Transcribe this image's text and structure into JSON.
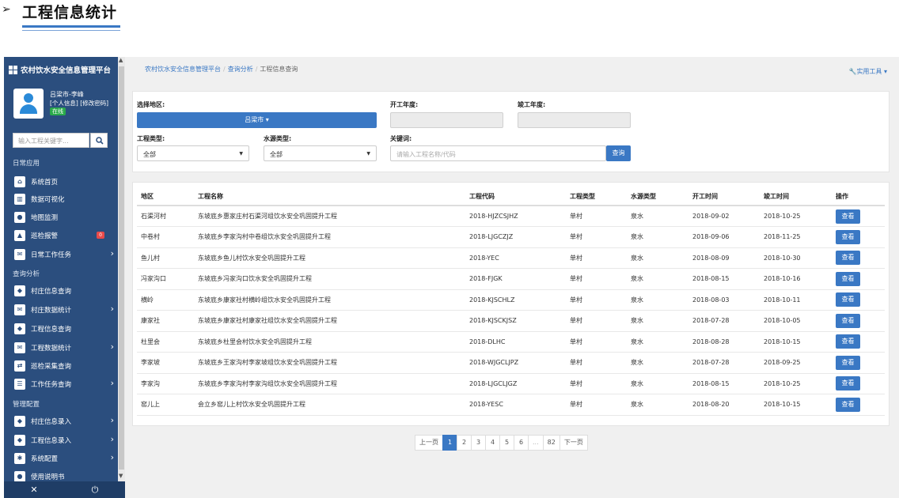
{
  "heading": {
    "arrow": "➢",
    "title": "工程信息统计"
  },
  "sidebar": {
    "brand": "农村饮水安全信息管理平台",
    "user": {
      "name": "吕梁市-李峰",
      "links": "[个人信息] [修改密码]",
      "status": "在线"
    },
    "search_placeholder": "输入工程关键字...",
    "groups": {
      "daily": "日常应用",
      "query": "查询分析",
      "config": "管理配置"
    },
    "items": [
      {
        "label": "系统首页",
        "icon": "⌂"
      },
      {
        "label": "数据可视化",
        "icon": "▥"
      },
      {
        "label": "地图监测",
        "icon": "●"
      },
      {
        "label": "巡检报警",
        "icon": "▲",
        "badge": "0"
      },
      {
        "label": "日常工作任务",
        "icon": "✉",
        "chev": "›"
      },
      {
        "label": "村庄信息查询",
        "icon": "◆"
      },
      {
        "label": "村庄数据统计",
        "icon": "✉",
        "chev": "›"
      },
      {
        "label": "工程信息查询",
        "icon": "◆"
      },
      {
        "label": "工程数据统计",
        "icon": "✉",
        "chev": "›"
      },
      {
        "label": "巡检采集查询",
        "icon": "⇄"
      },
      {
        "label": "工作任务查询",
        "icon": "☰",
        "chev": "›"
      },
      {
        "label": "村庄信息录入",
        "icon": "◆",
        "chev": "›"
      },
      {
        "label": "工程信息录入",
        "icon": "◆",
        "chev": "›"
      },
      {
        "label": "系统配置",
        "icon": "✱",
        "chev": "›"
      },
      {
        "label": "使用说明书",
        "icon": "●"
      }
    ],
    "bottom": {
      "left": "✕",
      "right": "⏻"
    }
  },
  "breadcrumb": {
    "a": "农村饮水安全信息管理平台",
    "b": "查询分析",
    "c": "工程信息查询"
  },
  "tools": "实用工具",
  "filters": {
    "region_label": "选择地区:",
    "region_value": "吕梁市",
    "start_label": "开工年度:",
    "end_label": "竣工年度:",
    "type_label": "工程类型:",
    "type_value": "全部",
    "water_label": "水源类型:",
    "water_value": "全部",
    "keyword_label": "关键词:",
    "keyword_placeholder": "请输入工程名称/代码",
    "query_button": "查询"
  },
  "table": {
    "headers": [
      "地区",
      "工程名称",
      "工程代码",
      "工程类型",
      "水源类型",
      "开工时间",
      "竣工时间",
      "操作"
    ],
    "action": "查看",
    "rows": [
      [
        "石渠河村",
        "东坡底乡惠家庄村石渠河组饮水安全巩固提升工程",
        "2018-HJZCSJHZ",
        "单村",
        "泉水",
        "2018-09-02",
        "2018-10-25"
      ],
      [
        "中卷村",
        "东坡底乡李家沟村中卷组饮水安全巩固提升工程",
        "2018-LJGCZJZ",
        "单村",
        "泉水",
        "2018-09-06",
        "2018-11-25"
      ],
      [
        "鱼儿村",
        "东坡底乡鱼儿村饮水安全巩固提升工程",
        "2018-YEC",
        "单村",
        "泉水",
        "2018-08-09",
        "2018-10-30"
      ],
      [
        "冯家沟口",
        "东坡底乡冯家沟口饮水安全巩固提升工程",
        "2018-FJGK",
        "单村",
        "泉水",
        "2018-08-15",
        "2018-10-16"
      ],
      [
        "横岭",
        "东坡底乡康家社村横岭组饮水安全巩固提升工程",
        "2018-KJSCHLZ",
        "单村",
        "泉水",
        "2018-08-03",
        "2018-10-11"
      ],
      [
        "康家社",
        "东坡底乡康家社村康家社组饮水安全巩固提升工程",
        "2018-KJSCKJSZ",
        "单村",
        "泉水",
        "2018-07-28",
        "2018-10-05"
      ],
      [
        "杜里会",
        "东坡底乡杜里会村饮水安全巩固提升工程",
        "2018-DLHC",
        "单村",
        "泉水",
        "2018-08-28",
        "2018-10-15"
      ],
      [
        "李家坡",
        "东坡底乡王家沟村李家坡组饮水安全巩固提升工程",
        "2018-WJGCLJPZ",
        "单村",
        "泉水",
        "2018-07-28",
        "2018-09-25"
      ],
      [
        "李家沟",
        "东坡底乡李家沟村李家沟组饮水安全巩固提升工程",
        "2018-LJGCLJGZ",
        "单村",
        "泉水",
        "2018-08-15",
        "2018-10-25"
      ],
      [
        "窑儿上",
        "会立乡窑儿上村饮水安全巩固提升工程",
        "2018-YESC",
        "单村",
        "泉水",
        "2018-08-20",
        "2018-10-15"
      ]
    ]
  },
  "pager": [
    "上一页",
    "1",
    "2",
    "3",
    "4",
    "5",
    "6",
    "...",
    "82",
    "下一页"
  ]
}
